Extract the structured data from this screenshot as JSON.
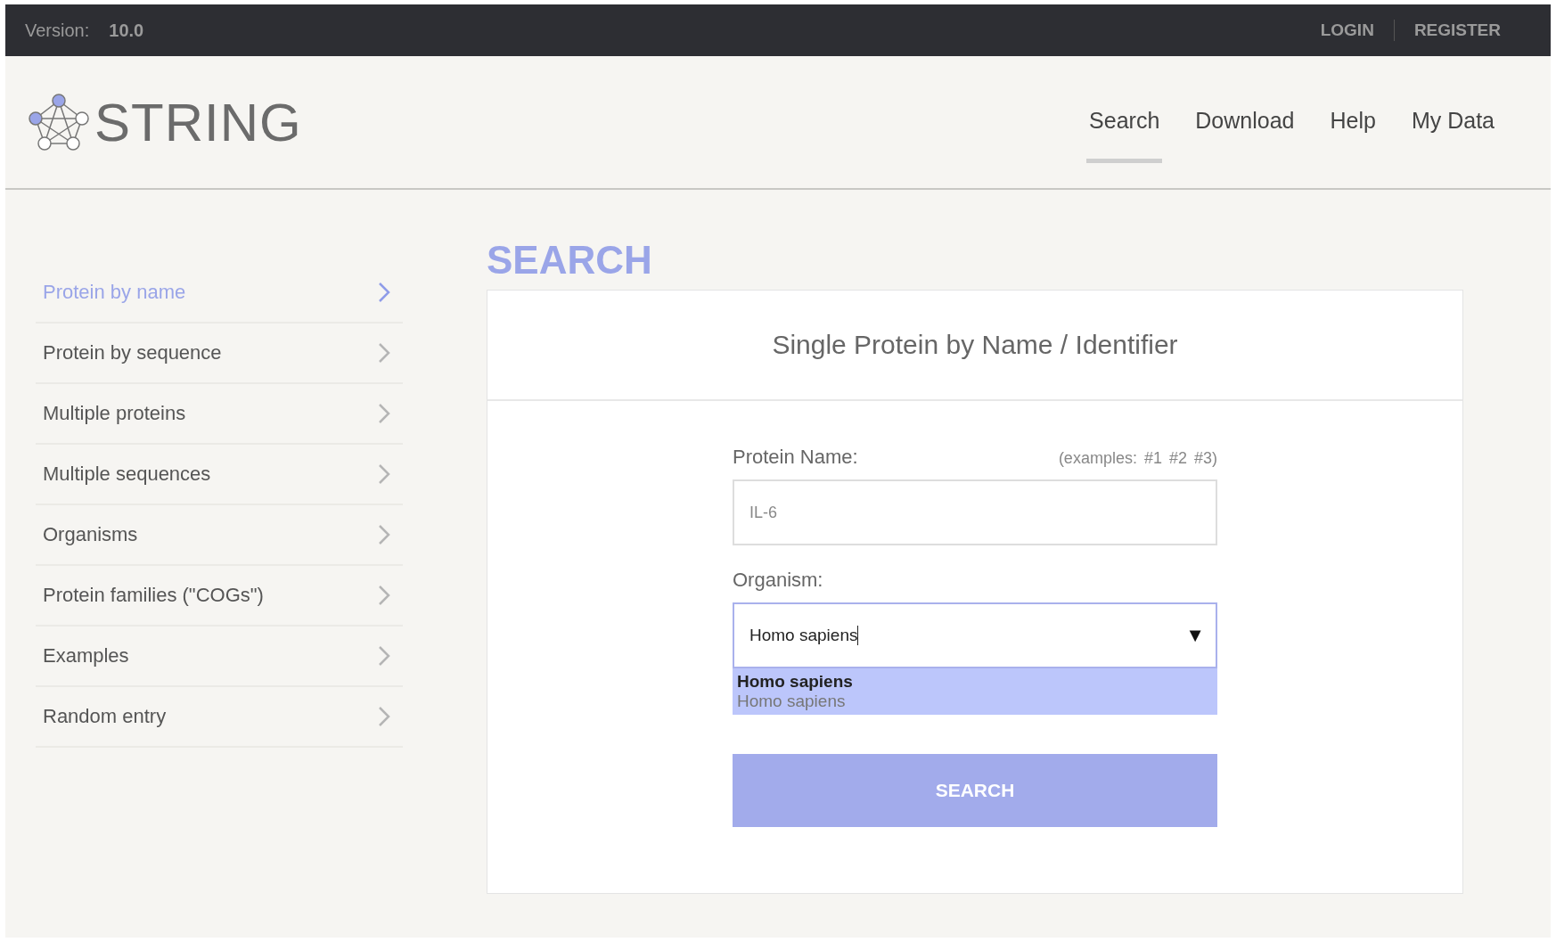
{
  "top_bar": {
    "version_label": "Version:",
    "version": "10.0",
    "links": [
      "LOGIN",
      "REGISTER"
    ]
  },
  "header": {
    "logo_text": "STRING",
    "nav": [
      {
        "label": "Search",
        "selected": true
      },
      {
        "label": "Download",
        "selected": false
      },
      {
        "label": "Help",
        "selected": false
      },
      {
        "label": "My Data",
        "selected": false
      }
    ]
  },
  "sidebar": {
    "items": [
      {
        "label": "Protein by name",
        "selected": true
      },
      {
        "label": "Protein by sequence",
        "selected": false
      },
      {
        "label": "Multiple proteins",
        "selected": false
      },
      {
        "label": "Multiple sequences",
        "selected": false
      },
      {
        "label": "Organisms",
        "selected": false
      },
      {
        "label": "Protein families (\"COGs\")",
        "selected": false
      },
      {
        "label": "Examples",
        "selected": false
      },
      {
        "label": "Random entry",
        "selected": false
      }
    ]
  },
  "main": {
    "title": "SEARCH",
    "card_title": "Single Protein by Name / Identifier",
    "protein_label": "Protein Name:",
    "examples_label": "(examples:",
    "example_links": [
      "#1",
      "#2",
      "#3"
    ],
    "examples_end": ")",
    "protein_placeholder": "IL-6",
    "organism_label": "Organism:",
    "organism_value": "Homo sapiens",
    "dropdown_arrow": "▼",
    "suggestions": [
      {
        "title": "Homo sapiens",
        "subtitle": "Homo sapiens",
        "selected": true
      }
    ],
    "button": "SEARCH"
  }
}
